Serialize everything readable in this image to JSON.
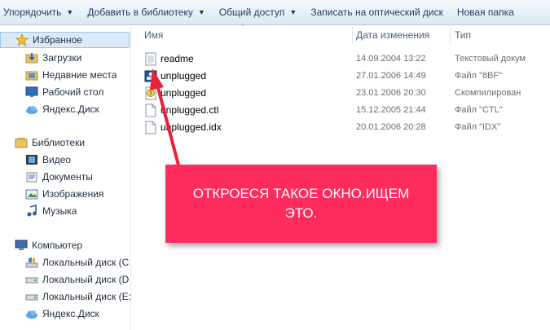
{
  "toolbar": {
    "items": [
      {
        "label": "Упорядочить",
        "has_dropdown": true
      },
      {
        "label": "Добавить в библиотеку",
        "has_dropdown": true
      },
      {
        "label": "Общий доступ",
        "has_dropdown": true
      },
      {
        "label": "Записать на оптический диск",
        "has_dropdown": false
      },
      {
        "label": "Новая папка",
        "has_dropdown": false
      }
    ]
  },
  "sidebar": {
    "favorites": {
      "label": "Избранное",
      "icon": "star-icon",
      "selected": true
    },
    "favorites_items": [
      {
        "label": "Загрузки",
        "icon": "downloads-folder-icon"
      },
      {
        "label": "Недавние места",
        "icon": "recent-places-icon"
      },
      {
        "label": "Рабочий стол",
        "icon": "desktop-icon"
      },
      {
        "label": "Яндекс.Диск",
        "icon": "cloud-icon"
      }
    ],
    "libraries": {
      "label": "Библиотеки",
      "icon": "library-icon"
    },
    "libraries_items": [
      {
        "label": "Видео",
        "icon": "video-icon"
      },
      {
        "label": "Документы",
        "icon": "documents-icon"
      },
      {
        "label": "Изображения",
        "icon": "pictures-icon"
      },
      {
        "label": "Музыка",
        "icon": "music-icon"
      }
    ],
    "computer": {
      "label": "Компьютер",
      "icon": "computer-icon"
    },
    "computer_items": [
      {
        "label": "Локальный диск (C",
        "icon": "drive-c-icon"
      },
      {
        "label": "Локальный диск (D",
        "icon": "drive-icon"
      },
      {
        "label": "Локальный диск (E:",
        "icon": "drive-icon"
      },
      {
        "label": "Яндекс.Диск",
        "icon": "cloud-icon"
      }
    ]
  },
  "columns": {
    "name": "Имя",
    "date": "Дата изменения",
    "type": "Тип"
  },
  "files": [
    {
      "name": "readme",
      "date": "14.09.2004 13:22",
      "type": "Текстовый докум",
      "icon": "text-file-icon"
    },
    {
      "name": "unplugged",
      "date": "27.01.2006 14:49",
      "type": "Файл \"8BF\"",
      "icon": "plugin-file-icon"
    },
    {
      "name": "unplugged",
      "date": "23.01.2006 20:30",
      "type": "Скомпилирован",
      "icon": "compiled-help-icon"
    },
    {
      "name": "unplugged.ctl",
      "date": "15.12.2005 21:44",
      "type": "Файл \"CTL\"",
      "icon": "generic-file-icon"
    },
    {
      "name": "unplugged.idx",
      "date": "20.01.2006 20:28",
      "type": "Файл \"IDX\"",
      "icon": "generic-file-icon"
    }
  ],
  "annotation": {
    "text": "ОТКРОЕСЯ ТАКОЕ ОКНО.ИЩЕМ ЭТО.",
    "box_color": "#fe2b5d",
    "arrow_color": "#e8203c"
  },
  "colors": {
    "selection": "#dbeaf7",
    "toolbar_text": "#1e395b"
  }
}
